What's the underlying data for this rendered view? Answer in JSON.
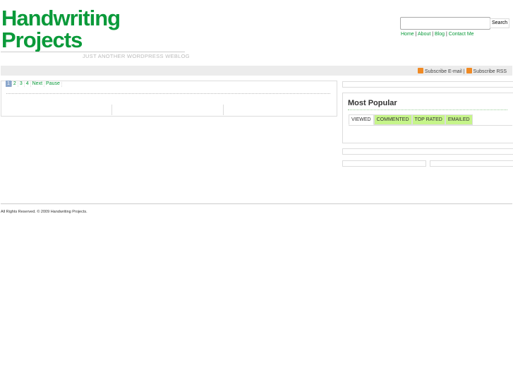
{
  "header": {
    "title_line1": "Handwriting",
    "title_line2": "Projects",
    "tagline": "JUST ANOTHER WORDPRESS WEBLOG"
  },
  "search": {
    "placeholder": "",
    "button": "Search"
  },
  "nav": [
    "Home",
    "About",
    "Blog",
    "Contact Me"
  ],
  "subscribe": {
    "email": "Subscribe E-mail",
    "rss": "Subscribe RSS",
    "separator": "|"
  },
  "slider": {
    "pages": [
      "1",
      "2",
      "3",
      "4"
    ],
    "next": "Next",
    "pause": "Pause"
  },
  "popular": {
    "title": "Most Popular",
    "tabs": [
      "VIEWED",
      "COMMENTED",
      "TOP RATED",
      "EMAILED"
    ]
  },
  "footer": {
    "text": "All Rights Reserved. © 2009 Handwriting Projects."
  }
}
